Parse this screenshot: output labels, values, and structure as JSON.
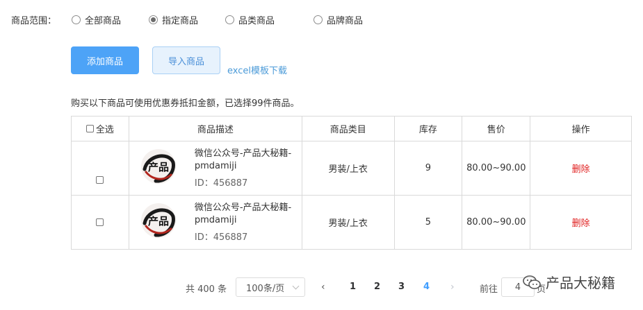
{
  "scope": {
    "label": "商品范围：",
    "options": [
      {
        "label": "全部商品",
        "checked": false
      },
      {
        "label": "指定商品",
        "checked": true
      },
      {
        "label": "品类商品",
        "checked": false
      },
      {
        "label": "品牌商品",
        "checked": false
      }
    ]
  },
  "actions": {
    "add_label": "添加商品",
    "import_label": "导入商品",
    "template_link": "excel模板下载"
  },
  "notice": "购买以下商品可使用优惠券抵扣金额，已选择99件商品。",
  "table": {
    "headers": {
      "select_all": "全选",
      "desc": "商品描述",
      "category": "商品类目",
      "stock": "库存",
      "price": "售价",
      "operation": "操作"
    },
    "rows": [
      {
        "name": "微信公众号-产品大秘籍-pmdamiji",
        "id": "ID：456887",
        "category": "男装/上衣",
        "stock": "9",
        "price": "80.00~90.00",
        "delete": "删除",
        "thumb_text": "产品"
      },
      {
        "name": "微信公众号-产品大秘籍-pmdamiji",
        "id": "ID：456887",
        "category": "男装/上衣",
        "stock": "5",
        "price": "80.00~90.00",
        "delete": "删除",
        "thumb_text": "产品"
      }
    ]
  },
  "pagination": {
    "total": "共 400 条",
    "page_size": "100条/页",
    "pages": [
      "1",
      "2",
      "3",
      "4"
    ],
    "current": "4",
    "goto_label": "前往",
    "goto_value": "4",
    "goto_suffix": "页"
  },
  "watermark": "产品大秘籍",
  "colors": {
    "primary": "#4da3f7",
    "link": "#4a9ad8",
    "danger": "#e02020",
    "active_page": "#409eff"
  }
}
